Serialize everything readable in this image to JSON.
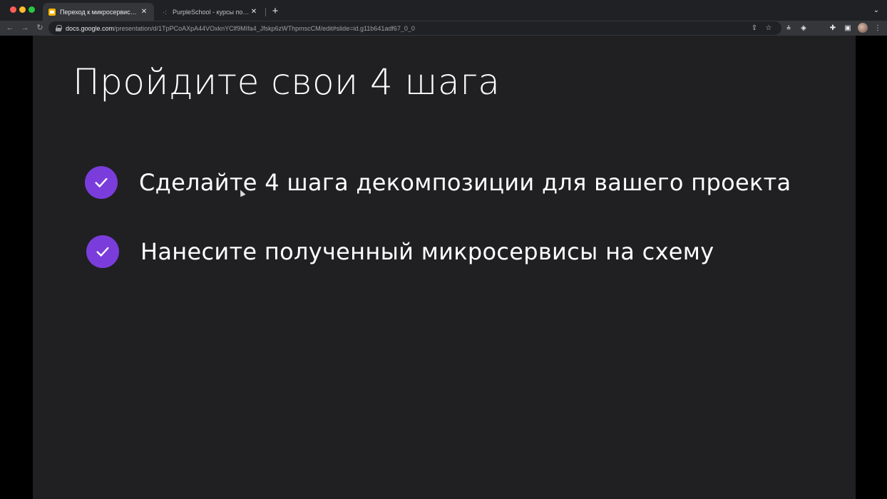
{
  "browser": {
    "tabs": [
      {
        "label": "Переход к микросервисам -",
        "active": true
      },
      {
        "label": "PurpleSchool - курсы по разр",
        "active": false
      }
    ],
    "url_host": "docs.google.com",
    "url_path": "/presentation/d/1TpPCoAXpA44VOxknYClf9MIfa4_Jfskp6zWThpmscCM/edit#slide=id.g11b641adf67_0_0"
  },
  "slide": {
    "title": "Пройдите свои 4 шага",
    "bullets": [
      "Сделайте 4 шага декомпозиции для вашего проекта",
      "Нанесите полученный микросервисы на схему"
    ]
  },
  "colors": {
    "slide_background": "#202022",
    "check_circle": "#7a3ddc",
    "browser_frame": "#202124"
  },
  "icons": {
    "check": "check-icon",
    "lock": "lock-icon"
  }
}
